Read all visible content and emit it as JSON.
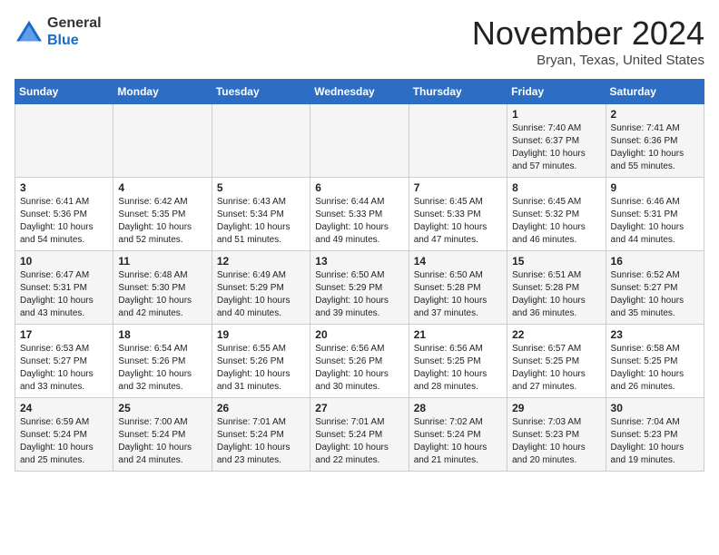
{
  "header": {
    "logo": {
      "line1": "General",
      "line2": "Blue"
    },
    "month": "November 2024",
    "location": "Bryan, Texas, United States"
  },
  "weekdays": [
    "Sunday",
    "Monday",
    "Tuesday",
    "Wednesday",
    "Thursday",
    "Friday",
    "Saturday"
  ],
  "weeks": [
    [
      {
        "day": "",
        "sunrise": "",
        "sunset": "",
        "daylight": ""
      },
      {
        "day": "",
        "sunrise": "",
        "sunset": "",
        "daylight": ""
      },
      {
        "day": "",
        "sunrise": "",
        "sunset": "",
        "daylight": ""
      },
      {
        "day": "",
        "sunrise": "",
        "sunset": "",
        "daylight": ""
      },
      {
        "day": "",
        "sunrise": "",
        "sunset": "",
        "daylight": ""
      },
      {
        "day": "1",
        "sunrise": "Sunrise: 7:40 AM",
        "sunset": "Sunset: 6:37 PM",
        "daylight": "Daylight: 10 hours and 57 minutes."
      },
      {
        "day": "2",
        "sunrise": "Sunrise: 7:41 AM",
        "sunset": "Sunset: 6:36 PM",
        "daylight": "Daylight: 10 hours and 55 minutes."
      }
    ],
    [
      {
        "day": "3",
        "sunrise": "Sunrise: 6:41 AM",
        "sunset": "Sunset: 5:36 PM",
        "daylight": "Daylight: 10 hours and 54 minutes."
      },
      {
        "day": "4",
        "sunrise": "Sunrise: 6:42 AM",
        "sunset": "Sunset: 5:35 PM",
        "daylight": "Daylight: 10 hours and 52 minutes."
      },
      {
        "day": "5",
        "sunrise": "Sunrise: 6:43 AM",
        "sunset": "Sunset: 5:34 PM",
        "daylight": "Daylight: 10 hours and 51 minutes."
      },
      {
        "day": "6",
        "sunrise": "Sunrise: 6:44 AM",
        "sunset": "Sunset: 5:33 PM",
        "daylight": "Daylight: 10 hours and 49 minutes."
      },
      {
        "day": "7",
        "sunrise": "Sunrise: 6:45 AM",
        "sunset": "Sunset: 5:33 PM",
        "daylight": "Daylight: 10 hours and 47 minutes."
      },
      {
        "day": "8",
        "sunrise": "Sunrise: 6:45 AM",
        "sunset": "Sunset: 5:32 PM",
        "daylight": "Daylight: 10 hours and 46 minutes."
      },
      {
        "day": "9",
        "sunrise": "Sunrise: 6:46 AM",
        "sunset": "Sunset: 5:31 PM",
        "daylight": "Daylight: 10 hours and 44 minutes."
      }
    ],
    [
      {
        "day": "10",
        "sunrise": "Sunrise: 6:47 AM",
        "sunset": "Sunset: 5:31 PM",
        "daylight": "Daylight: 10 hours and 43 minutes."
      },
      {
        "day": "11",
        "sunrise": "Sunrise: 6:48 AM",
        "sunset": "Sunset: 5:30 PM",
        "daylight": "Daylight: 10 hours and 42 minutes."
      },
      {
        "day": "12",
        "sunrise": "Sunrise: 6:49 AM",
        "sunset": "Sunset: 5:29 PM",
        "daylight": "Daylight: 10 hours and 40 minutes."
      },
      {
        "day": "13",
        "sunrise": "Sunrise: 6:50 AM",
        "sunset": "Sunset: 5:29 PM",
        "daylight": "Daylight: 10 hours and 39 minutes."
      },
      {
        "day": "14",
        "sunrise": "Sunrise: 6:50 AM",
        "sunset": "Sunset: 5:28 PM",
        "daylight": "Daylight: 10 hours and 37 minutes."
      },
      {
        "day": "15",
        "sunrise": "Sunrise: 6:51 AM",
        "sunset": "Sunset: 5:28 PM",
        "daylight": "Daylight: 10 hours and 36 minutes."
      },
      {
        "day": "16",
        "sunrise": "Sunrise: 6:52 AM",
        "sunset": "Sunset: 5:27 PM",
        "daylight": "Daylight: 10 hours and 35 minutes."
      }
    ],
    [
      {
        "day": "17",
        "sunrise": "Sunrise: 6:53 AM",
        "sunset": "Sunset: 5:27 PM",
        "daylight": "Daylight: 10 hours and 33 minutes."
      },
      {
        "day": "18",
        "sunrise": "Sunrise: 6:54 AM",
        "sunset": "Sunset: 5:26 PM",
        "daylight": "Daylight: 10 hours and 32 minutes."
      },
      {
        "day": "19",
        "sunrise": "Sunrise: 6:55 AM",
        "sunset": "Sunset: 5:26 PM",
        "daylight": "Daylight: 10 hours and 31 minutes."
      },
      {
        "day": "20",
        "sunrise": "Sunrise: 6:56 AM",
        "sunset": "Sunset: 5:26 PM",
        "daylight": "Daylight: 10 hours and 30 minutes."
      },
      {
        "day": "21",
        "sunrise": "Sunrise: 6:56 AM",
        "sunset": "Sunset: 5:25 PM",
        "daylight": "Daylight: 10 hours and 28 minutes."
      },
      {
        "day": "22",
        "sunrise": "Sunrise: 6:57 AM",
        "sunset": "Sunset: 5:25 PM",
        "daylight": "Daylight: 10 hours and 27 minutes."
      },
      {
        "day": "23",
        "sunrise": "Sunrise: 6:58 AM",
        "sunset": "Sunset: 5:25 PM",
        "daylight": "Daylight: 10 hours and 26 minutes."
      }
    ],
    [
      {
        "day": "24",
        "sunrise": "Sunrise: 6:59 AM",
        "sunset": "Sunset: 5:24 PM",
        "daylight": "Daylight: 10 hours and 25 minutes."
      },
      {
        "day": "25",
        "sunrise": "Sunrise: 7:00 AM",
        "sunset": "Sunset: 5:24 PM",
        "daylight": "Daylight: 10 hours and 24 minutes."
      },
      {
        "day": "26",
        "sunrise": "Sunrise: 7:01 AM",
        "sunset": "Sunset: 5:24 PM",
        "daylight": "Daylight: 10 hours and 23 minutes."
      },
      {
        "day": "27",
        "sunrise": "Sunrise: 7:01 AM",
        "sunset": "Sunset: 5:24 PM",
        "daylight": "Daylight: 10 hours and 22 minutes."
      },
      {
        "day": "28",
        "sunrise": "Sunrise: 7:02 AM",
        "sunset": "Sunset: 5:24 PM",
        "daylight": "Daylight: 10 hours and 21 minutes."
      },
      {
        "day": "29",
        "sunrise": "Sunrise: 7:03 AM",
        "sunset": "Sunset: 5:23 PM",
        "daylight": "Daylight: 10 hours and 20 minutes."
      },
      {
        "day": "30",
        "sunrise": "Sunrise: 7:04 AM",
        "sunset": "Sunset: 5:23 PM",
        "daylight": "Daylight: 10 hours and 19 minutes."
      }
    ]
  ]
}
